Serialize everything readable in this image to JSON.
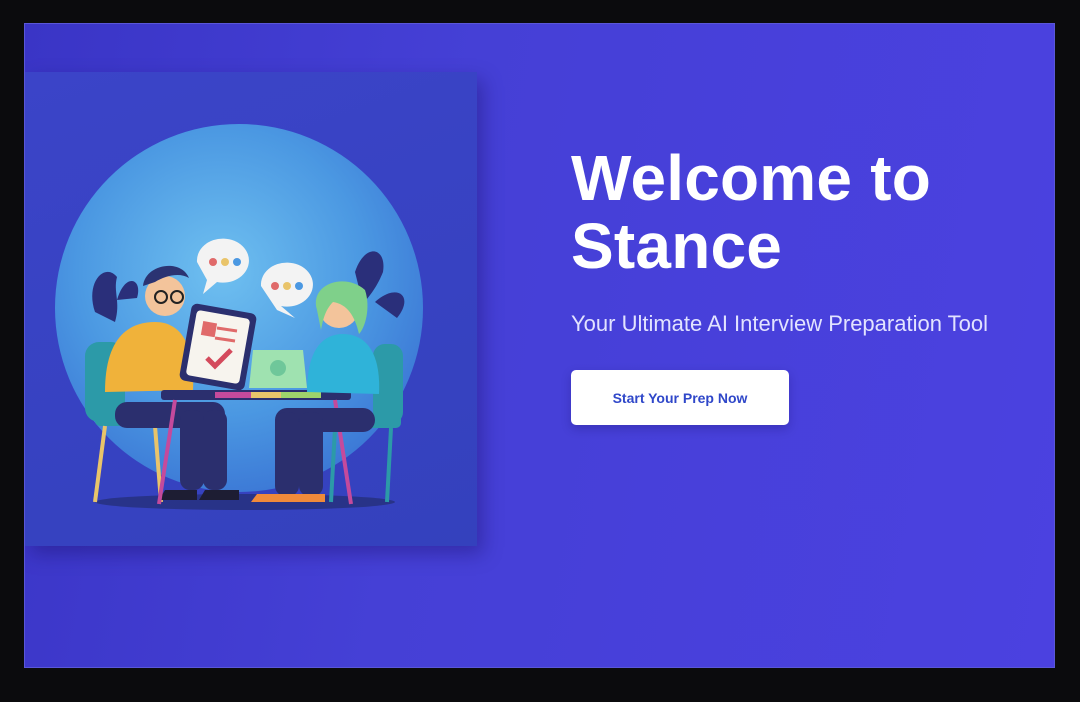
{
  "hero": {
    "title_line1": "Welcome to",
    "title_line2": "Stance",
    "subtitle": "Your Ultimate AI Interview Preparation Tool",
    "cta_label": "Start Your Prep Now",
    "illustration": "interview-illustration"
  },
  "colors": {
    "background": "#4540d6",
    "panel": "#3b44c8",
    "button_bg": "#ffffff",
    "button_text": "#2f47c9",
    "title": "#ffffff"
  }
}
